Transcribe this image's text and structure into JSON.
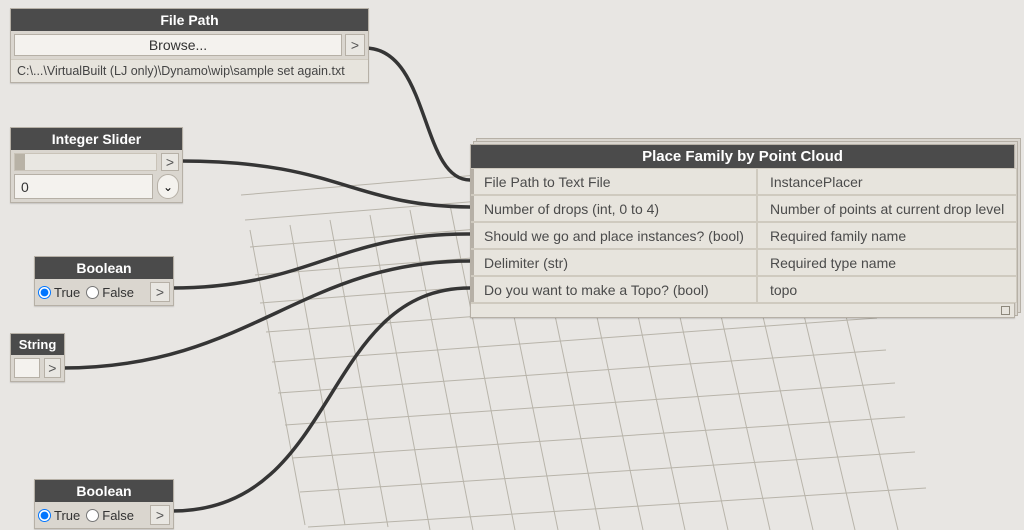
{
  "nodes": {
    "filePath": {
      "title": "File Path",
      "browseLabel": "Browse...",
      "pathText": "C:\\...\\VirtualBuilt (LJ only)\\Dynamo\\wip\\sample set again.txt"
    },
    "integerSlider": {
      "title": "Integer Slider",
      "value": "0"
    },
    "boolean1": {
      "title": "Boolean",
      "trueLabel": "True",
      "falseLabel": "False"
    },
    "string": {
      "title": "String",
      "value": ""
    },
    "boolean2": {
      "title": "Boolean",
      "trueLabel": "True",
      "falseLabel": "False"
    },
    "placeFamily": {
      "title": "Place Family by Point Cloud",
      "inputs": [
        "File Path to Text File",
        "Number of drops (int, 0 to 4)",
        "Should we go and place instances? (bool)",
        "Delimiter (str)",
        "Do you want to make a Topo? (bool)"
      ],
      "outputs": [
        "InstancePlacer",
        "Number of points at current drop level",
        "Required family name",
        "Required type name",
        "topo"
      ]
    }
  },
  "glyphs": {
    "outPort": ">",
    "spinner": "⌄"
  }
}
